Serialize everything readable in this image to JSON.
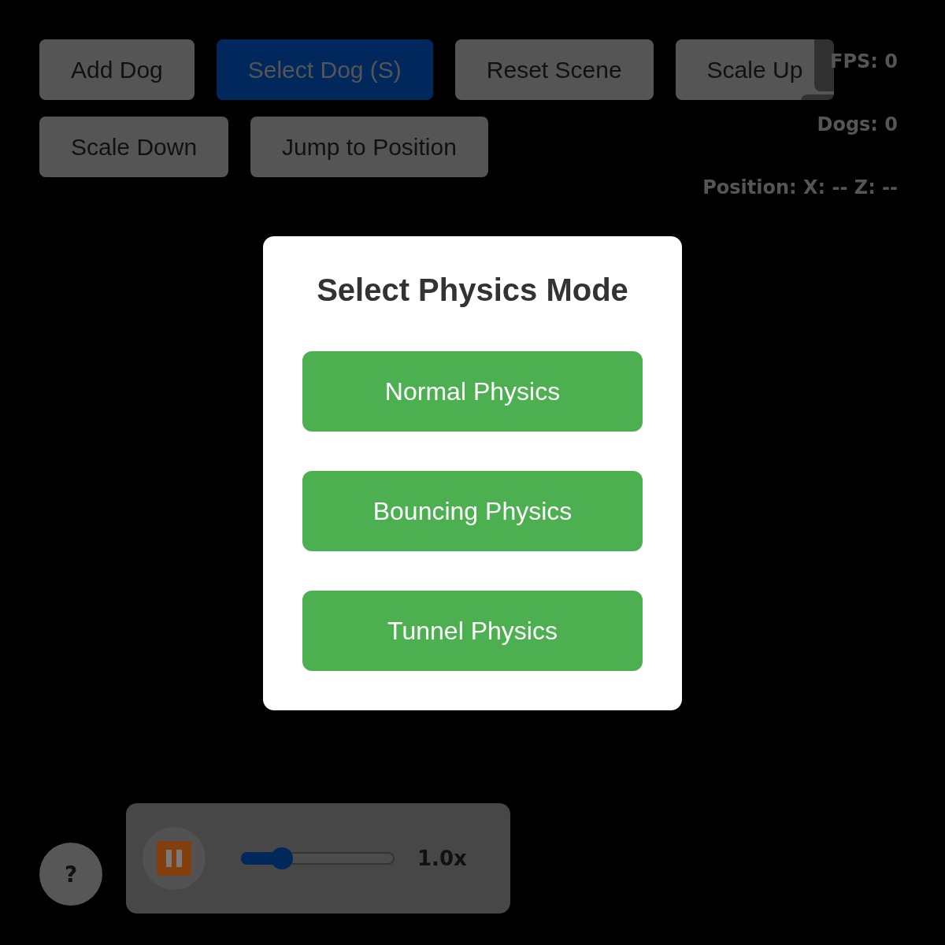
{
  "toolbar": {
    "buttons": [
      {
        "label": "Add Dog",
        "active": false
      },
      {
        "label": "Select Dog (S)",
        "active": true
      },
      {
        "label": "Reset Scene",
        "active": false
      },
      {
        "label": "Scale Up",
        "active": false
      },
      {
        "label": "Scale Down",
        "active": false
      },
      {
        "label": "Jump to Position",
        "active": false
      }
    ]
  },
  "stats": [
    "FPS: 0",
    "Dogs: 0",
    "Position: X: -- Z: --"
  ],
  "dialog": {
    "title": "Select Physics Mode",
    "options": [
      "Normal Physics",
      "Bouncing Physics",
      "Tunnel Physics"
    ]
  },
  "help_button": {
    "label": "?"
  },
  "playback": {
    "playing": true,
    "level": 0.23,
    "reading": "1.0x"
  }
}
